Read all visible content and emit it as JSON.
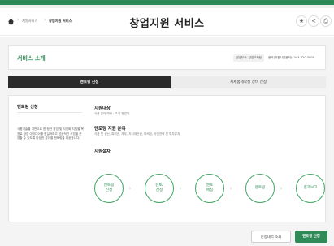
{
  "header": {
    "breadcrumb": [
      "지원서비스",
      "창업지원 서비스"
    ],
    "title": "창업지원 서비스"
  },
  "service": {
    "title": "서비스 소개",
    "dept_tag": "담당부서: 창업교육팀",
    "contact": "문의(지원사업문의): 043-720-0800"
  },
  "tabs": [
    {
      "label": "멘토링 신청",
      "active": true
    },
    {
      "label": "시제품제작실 장비 신청",
      "active": false
    }
  ],
  "left_panel": {
    "title": "멘토링 신청",
    "description": "식품기술을 기반으로 한 청년 창업 및 사업화 지원을 목표로 창업 아이디어를 현실화하고 성공적인 사업을 운영할 수 있도록 다양한 분야별 멘토링을 제공합니다."
  },
  "target": {
    "title": "지원대상",
    "text": "식품 분야 예비 · 초기 창업자"
  },
  "fields": {
    "title": "멘토링 지원 분야",
    "text": "식품 및 생산, 특허권, 재무, 지식재산권, 마케팅, 사업전략 및 투자유치"
  },
  "procedure": {
    "title": "지원절차",
    "steps": [
      "멘토링\n신청",
      "검토/\n선정",
      "멘토\n매칭",
      "멘토링",
      "결과보고"
    ]
  },
  "actions": {
    "history_button": "신청내역 조회",
    "apply_button": "멘토링 신청"
  },
  "colors": {
    "accent": "#2e8b57",
    "dark_tab": "#2b2b2b"
  }
}
